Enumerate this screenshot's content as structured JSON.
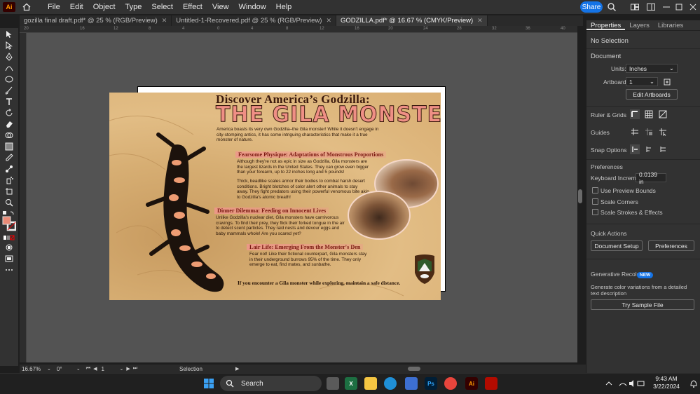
{
  "app": {
    "logo": "Ai",
    "menu": [
      "File",
      "Edit",
      "Object",
      "Type",
      "Select",
      "Effect",
      "View",
      "Window",
      "Help"
    ],
    "share_label": "Share"
  },
  "tabs": [
    {
      "label": "gozilla final draft.pdf* @ 25 % (RGB/Preview)",
      "close": "✕"
    },
    {
      "label": "Untitled-1-Recovered.pdf @ 25 % (RGB/Preview)",
      "close": "✕"
    },
    {
      "label": "GODZILLA.pdf* @ 16.67 % (CMYK/Preview)",
      "close": "✕"
    }
  ],
  "ruler_ticks": [
    "20",
    "16",
    "12",
    "8",
    "4",
    "0",
    "4",
    "8",
    "12",
    "16",
    "20",
    "24",
    "28",
    "32",
    "36",
    "40"
  ],
  "artwork": {
    "title_line1": "Discover America’s Godzilla:",
    "title_line2": "THE GILA MONSTER",
    "intro": "America boasts its very own Godzilla–the Gila monster! While it doesn't engage in city-stomping antics, it has some intriguing characteristics that make it a true monster of nature.",
    "section1_head": "Fearsome Physique: Adaptations of Monstrous Proportions",
    "section1_p1": "Although they're not as epic in size as Godzilla, Gila monsters are the largest lizards in the United States. They can grow even bigger than your forearm, up to 22 inches long and 5 pounds!",
    "section1_p2": "Thick, beadlike scales armor their bodies to combat harsh desert conditions. Bright blotches of color alert other animals to stay away. They fight predators using their powerful venomous bite akin to Godzilla's atomic breath!",
    "section2_head": "Dinner Dilemma: Feeding on Innocent Lives",
    "section2_p": "Unlike Godzilla's nuclear diet, Gila monsters have carnivorous cravings. To find their prey, they flick their forked tongue in the air to detect scent particles. They raid nests and devour eggs and baby mammals whole! Are you scared yet?",
    "section3_head": "Lair Life: Emerging From the Monster's Den",
    "section3_p": "Fear not! Like their fictional counterpart, Gila monsters stay in their underground burrows 95% of the time. They only emerge to eat, find mates, and sunbathe.",
    "footer_note": "If you encounter a Gila monster while exploring, maintain a safe distance."
  },
  "panel": {
    "tabs": [
      "Properties",
      "Layers",
      "Libraries"
    ],
    "no_selection": "No Selection",
    "document_label": "Document",
    "units_label": "Units:",
    "units_value": "Inches",
    "artboard_label": "Artboard:",
    "artboard_value": "1",
    "edit_artboards": "Edit Artboards",
    "ruler_grids": "Ruler & Grids",
    "guides": "Guides",
    "snap_options": "Snap Options",
    "preferences_label": "Preferences",
    "keyboard_increment_label": "Keyboard Increment:",
    "keyboard_increment_value": "0.0139 in",
    "use_preview_bounds": "Use Preview Bounds",
    "scale_corners": "Scale Corners",
    "scale_strokes": "Scale Strokes & Effects",
    "quick_actions": "Quick Actions",
    "document_setup": "Document Setup",
    "preferences_btn": "Preferences",
    "generative_recolor": "Generative Recolor",
    "new_badge": "NEW",
    "gen_desc": "Generate color variations from a detailed text description",
    "try_sample": "Try Sample File"
  },
  "status": {
    "zoom": "16.67%",
    "rotation": "0°",
    "artboard_nav": "1",
    "tool_name": "Selection"
  },
  "taskbar": {
    "search_label": "Search",
    "time": "9:43 AM",
    "date": "3/22/2024"
  },
  "colors": {
    "accent": "#1473e6",
    "ui_bg": "#323232",
    "canvas_bg": "#535353",
    "title_pink": "#ef8f85"
  }
}
